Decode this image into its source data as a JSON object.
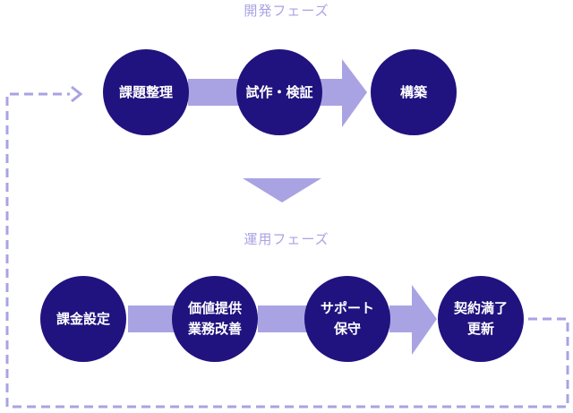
{
  "phases": {
    "development": {
      "label": "開発フェーズ",
      "steps": [
        "課題整理",
        "試作・検証",
        "構築"
      ]
    },
    "operation": {
      "label": "運用フェーズ",
      "steps": [
        "課金設定",
        "価値提供\n業務改善",
        "サポート\n保守",
        "契約満了\n更新"
      ]
    }
  },
  "colors": {
    "node": "#20137f",
    "connector": "#a9a3e3",
    "label": "#a9a3e3",
    "dashed": "#a9a3e3"
  },
  "icons": {
    "flow-arrow": "right-arrow",
    "phase-transition": "down-triangle",
    "loop": "dashed-return-arrow"
  }
}
